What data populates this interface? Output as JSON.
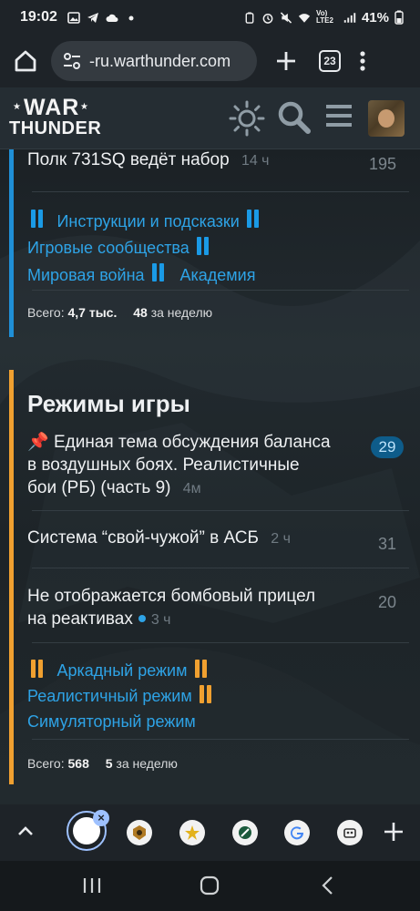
{
  "status_bar": {
    "time": "19:02",
    "signal_label": "Vo) LTE2",
    "battery": "41%"
  },
  "browser": {
    "url": "-ru.warthunder.com",
    "tab_count": "23",
    "home_icon": "home-icon",
    "site_settings_icon": "tune-icon",
    "new_tab_icon": "plus-icon",
    "menu_icon": "more-vert-icon"
  },
  "site_header": {
    "logo_line1": "WAR",
    "logo_line2": "THUNDER",
    "theme_icon": "sun-icon",
    "search_icon": "search-icon",
    "menu_icon": "hamburger-icon"
  },
  "category1": {
    "accent": "#1f8fd6",
    "topic": {
      "title": "Полк 731SQ ведёт набор",
      "age": "14 ч",
      "replies": "195"
    },
    "subcategories": [
      {
        "label": "Инструкции и подсказки"
      },
      {
        "label": "Игровые сообщества"
      },
      {
        "label": "Мировая война"
      },
      {
        "label": "Академия"
      }
    ],
    "totals": {
      "label": "Всего:",
      "total": "4,7 тыс.",
      "week_count": "48",
      "week_label": "за неделю"
    }
  },
  "category2": {
    "accent": "#f0a030",
    "title": "Режимы игры",
    "topics": [
      {
        "title_line1": "Единая тема обсуждения баланса",
        "title_line2": "в воздушных боях. Реалистичные",
        "title_line3": "бои (РБ) (часть 9)",
        "age": "4м",
        "replies": "29",
        "pinned": true
      },
      {
        "title": "Система “свой-чужой” в АСБ",
        "age": "2 ч",
        "replies": "31"
      },
      {
        "title_line1": "Не отображается бомбовый прицел",
        "title_line2": "на реактивах",
        "age": "3 ч",
        "replies": "20",
        "unread": true
      }
    ],
    "subcategories": [
      {
        "label": "Аркадный режим"
      },
      {
        "label": "Реалистичный режим"
      },
      {
        "label": "Симуляторный режим"
      }
    ],
    "totals": {
      "label": "Всего:",
      "total": "568",
      "week_count": "5",
      "week_label": "за неделю"
    }
  },
  "tab_strip": {
    "close_glyph": "×",
    "tabs": [
      "warthunder-favicon",
      "star-favicon",
      "sword-favicon",
      "google-favicon",
      "robot-favicon"
    ]
  },
  "colors": {
    "link": "#2ea3e6",
    "blue_accent": "#1f8fd6",
    "orange_accent": "#f0a030",
    "badge_bg": "#0e5c8a"
  }
}
